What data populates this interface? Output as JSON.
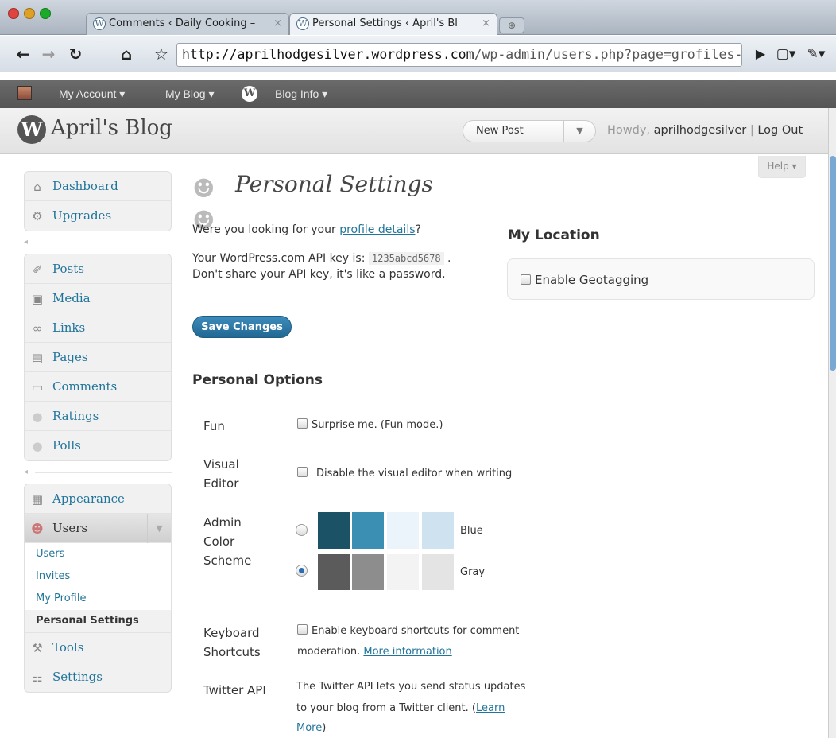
{
  "browser": {
    "tabs": [
      {
        "title": "Comments ‹ Daily Cooking –"
      },
      {
        "title": "Personal Settings ‹ April's Bl"
      }
    ],
    "tab_close": "×",
    "new_tab": "⊕",
    "url_domain": "http://aprilhodgesilver.wordpress.com",
    "url_path": "/wp-admin/users.php?page=grofiles-user-se",
    "traffic_colors": [
      "#e0443e",
      "#dea123",
      "#1aab29"
    ]
  },
  "adminbar": {
    "my_account": "My Account ▾",
    "my_blog": "My Blog ▾",
    "blog_info": "Blog Info ▾"
  },
  "header": {
    "blog_title": "April's Blog",
    "new_post": "New Post",
    "howdy_prefix": "Howdy,",
    "username": "aprilhodgesilver",
    "separator": "|",
    "logout": "Log Out"
  },
  "help": "Help ▾",
  "sidebar": {
    "group1": [
      {
        "label": "Dashboard",
        "icon": "home-icon",
        "glyph": "⌂"
      },
      {
        "label": "Upgrades",
        "icon": "gear-icon",
        "glyph": "⚙"
      }
    ],
    "group2": [
      {
        "label": "Posts",
        "icon": "pushpin-icon",
        "glyph": "✐"
      },
      {
        "label": "Media",
        "icon": "media-icon",
        "glyph": "▣"
      },
      {
        "label": "Links",
        "icon": "link-icon",
        "glyph": "∞"
      },
      {
        "label": "Pages",
        "icon": "pages-icon",
        "glyph": "▤"
      },
      {
        "label": "Comments",
        "icon": "comment-icon",
        "glyph": "▭"
      },
      {
        "label": "Ratings",
        "icon": "ratings-icon",
        "glyph": "●"
      },
      {
        "label": "Polls",
        "icon": "polls-icon",
        "glyph": "●"
      }
    ],
    "appearance": "Appearance",
    "users": "Users",
    "users_sub": [
      "Users",
      "Invites",
      "My Profile",
      "Personal Settings"
    ],
    "tools": "Tools",
    "settings": "Settings"
  },
  "page": {
    "title": "Personal Settings",
    "profile_prefix": "Were you looking for your ",
    "profile_link": "profile details",
    "profile_suffix": "?",
    "api_prefix": "Your WordPress.com API key is:",
    "api_key": "1235abcd5678",
    "api_suffix": ".",
    "api_warning": "Don't share your API key, it's like a password.",
    "save": "Save Changes",
    "my_location": "My Location",
    "geotag": "Enable Geotagging",
    "personal_options": "Personal Options",
    "fun_label": "Fun",
    "fun_text": "Surprise me. (Fun mode.)",
    "visual_label_1": "Visual",
    "visual_label_2": "Editor",
    "visual_text": "Disable the visual editor when writing",
    "scheme_label_1": "Admin",
    "scheme_label_2": "Color",
    "scheme_label_3": "Scheme",
    "schemes": [
      {
        "name": "Blue",
        "colors": [
          "#1c5266",
          "#3b8fb3",
          "#ebf3fb",
          "#cfe2ef"
        ],
        "selected": false
      },
      {
        "name": "Gray",
        "colors": [
          "#5b5b5b",
          "#8d8d8d",
          "#f3f3f3",
          "#e4e4e4"
        ],
        "selected": true
      }
    ],
    "kb_label_1": "Keyboard",
    "kb_label_2": "Shortcuts",
    "kb_text": "Enable keyboard shortcuts for comment",
    "kb_text2": "moderation.",
    "kb_link": "More information",
    "twitter_label": "Twitter API",
    "twitter_text1": "The Twitter API lets you send status updates",
    "twitter_text2": "to your blog from a Twitter client. (",
    "twitter_link1": "Learn",
    "twitter_link2": "More",
    "twitter_end": ")"
  }
}
